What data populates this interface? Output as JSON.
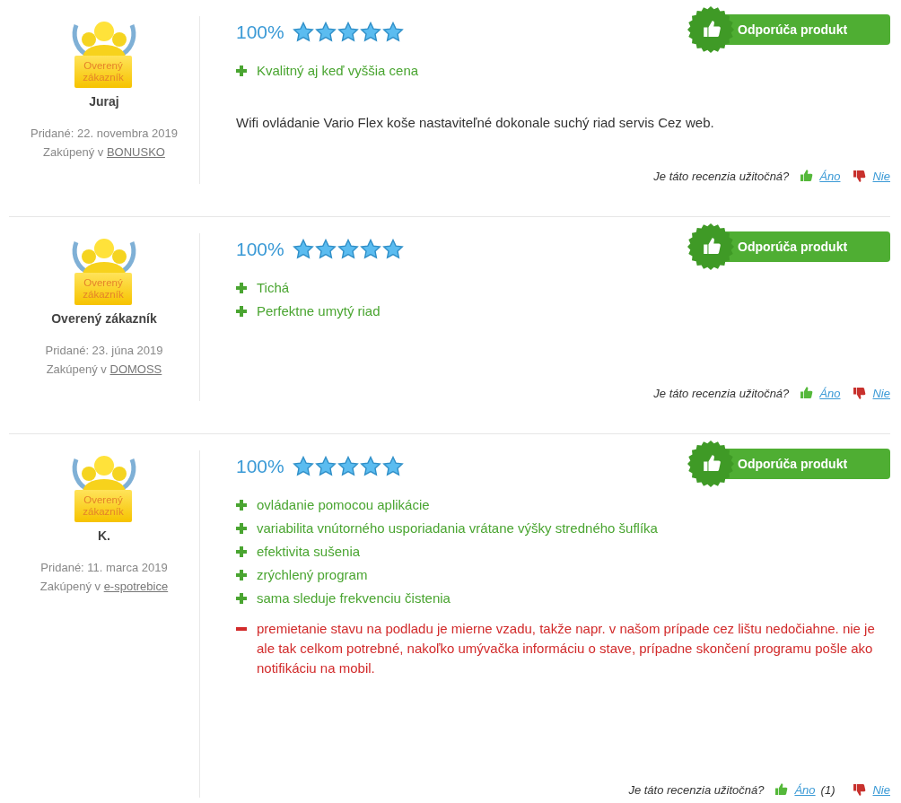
{
  "reviews": [
    {
      "author": "Juraj",
      "badge_label": "Overený zákazník",
      "added": "Pridané: 22. novembra 2019",
      "bought_prefix": "Zakúpený v",
      "shop": "BONUSKO",
      "percent": "100%",
      "stars": 5,
      "recommends": true,
      "recommend_label": "Odporúča produkt",
      "points": [
        {
          "kind": "pro",
          "text": "Kvalitný aj keď vyššia cena"
        }
      ],
      "text": "Wifi ovládanie Vario Flex koše nastaviteľné dokonale suchý riad servis Cez web.",
      "helpful_question": "Je táto recenzia užitočná?",
      "yes": "Áno",
      "no": "Nie"
    },
    {
      "author": "Overený zákazník",
      "badge_label": "Overený zákazník",
      "added": "Pridané: 23. júna 2019",
      "bought_prefix": "Zakúpený v",
      "shop": "DOMOSS",
      "percent": "100%",
      "stars": 5,
      "recommends": true,
      "recommend_label": "Odporúča produkt",
      "points": [
        {
          "kind": "pro",
          "text": "Tichá"
        },
        {
          "kind": "pro",
          "text": "Perfektne umytý riad"
        }
      ],
      "helpful_question": "Je táto recenzia užitočná?",
      "yes": "Áno",
      "no": "Nie"
    },
    {
      "author": "K.",
      "badge_label": "Overený zákazník",
      "added": "Pridané: 11. marca 2019",
      "bought_prefix": "Zakúpený v",
      "shop": "e-spotrebice",
      "percent": "100%",
      "stars": 5,
      "recommends": true,
      "recommend_label": "Odporúča produkt",
      "points": [
        {
          "kind": "pro",
          "text": "ovládanie pomocou aplikácie"
        },
        {
          "kind": "pro",
          "text": "variabilita vnútorného usporiadania vrátane výšky stredného šuflíka"
        },
        {
          "kind": "pro",
          "text": "efektivita sušenia"
        },
        {
          "kind": "pro",
          "text": "zrýchlený program"
        },
        {
          "kind": "pro",
          "text": "sama sleduje frekvenciu čistenia"
        },
        {
          "kind": "con",
          "text": "premietanie stavu na podladu je mierne vzadu, takže napr. v našom prípade cez lištu nedočiahne. nie je ale tak celkom potrebné, nakoľko umývačka informáciu o stave, prípadne skončení programu pošle ako notifikáciu na mobil."
        }
      ],
      "helpful_question": "Je táto recenzia užitočná?",
      "yes": "Áno",
      "yes_count": "(1)",
      "no": "Nie"
    }
  ]
}
